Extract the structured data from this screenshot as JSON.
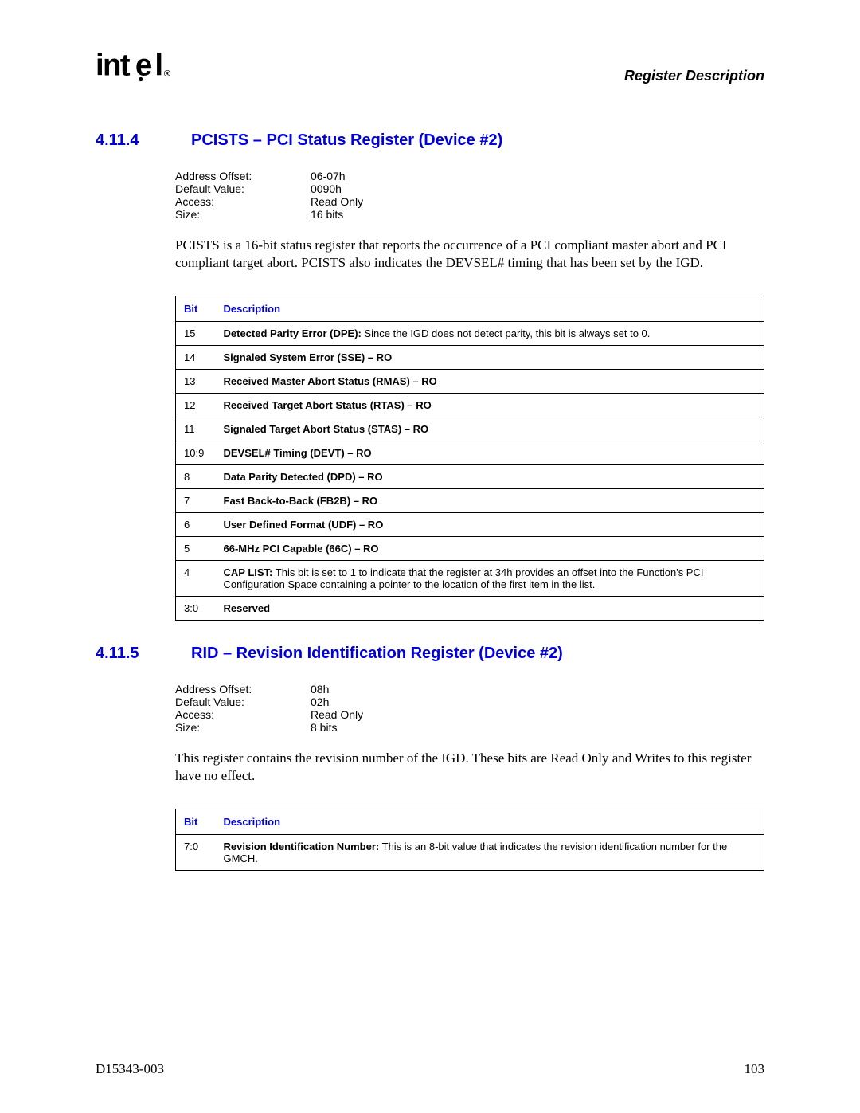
{
  "header": {
    "title": "Register Description",
    "logo_alt": "intel"
  },
  "footer": {
    "doc_number": "D15343-003",
    "page_number": "103"
  },
  "sections": [
    {
      "num": "4.11.4",
      "title": "PCISTS – PCI Status Register (Device #2)",
      "kv": [
        {
          "label": "Address Offset:",
          "value": "06-07h"
        },
        {
          "label": "Default Value:",
          "value": "0090h"
        },
        {
          "label": "Access:",
          "value": "Read Only"
        },
        {
          "label": "Size:",
          "value": "16 bits"
        }
      ],
      "body": "PCISTS is a 16-bit status register that reports the occurrence of a PCI compliant master abort and PCI compliant target abort. PCISTS also indicates the DEVSEL# timing that has been set by the IGD.",
      "table": {
        "headers": {
          "bit": "Bit",
          "desc": "Description"
        },
        "rows": [
          {
            "bit": "15",
            "bold": "Detected Parity Error (DPE):",
            "rest": "  Since the IGD does not detect parity, this bit is always set to 0."
          },
          {
            "bit": "14",
            "bold": "Signaled System Error (SSE) – RO",
            "rest": ""
          },
          {
            "bit": "13",
            "bold": "Received Master Abort Status (RMAS) – RO",
            "rest": ""
          },
          {
            "bit": "12",
            "bold": "Received Target Abort Status (RTAS) – RO",
            "rest": ""
          },
          {
            "bit": "11",
            "bold": "Signaled Target Abort Status (STAS) – RO",
            "rest": ""
          },
          {
            "bit": "10:9",
            "bold": "DEVSEL# Timing (DEVT) – RO",
            "rest": ""
          },
          {
            "bit": "8",
            "bold": "Data Parity Detected (DPD) – RO",
            "rest": ""
          },
          {
            "bit": "7",
            "bold": "Fast Back-to-Back (FB2B) – RO",
            "rest": ""
          },
          {
            "bit": "6",
            "bold": "User Defined Format (UDF) – RO",
            "rest": ""
          },
          {
            "bit": "5",
            "bold": "66-MHz PCI Capable (66C) – RO",
            "rest": ""
          },
          {
            "bit": "4",
            "bold": "CAP LIST:",
            "rest": "  This bit is set to 1 to indicate that the register at 34h provides an offset into the Function's PCI Configuration Space containing a pointer to the location of the first item in the list."
          },
          {
            "bit": "3:0",
            "bold": "Reserved",
            "rest": ""
          }
        ]
      }
    },
    {
      "num": "4.11.5",
      "title": "RID – Revision Identification Register (Device #2)",
      "kv": [
        {
          "label": "Address Offset:",
          "value": "08h"
        },
        {
          "label": "Default Value:",
          "value": "02h"
        },
        {
          "label": "Access:",
          "value": "Read Only"
        },
        {
          "label": "Size:",
          "value": "8 bits"
        }
      ],
      "body": "This register contains the revision number of the IGD. These bits are Read Only and Writes to this register have no effect.",
      "table": {
        "headers": {
          "bit": "Bit",
          "desc": "Description"
        },
        "rows": [
          {
            "bit": "7:0",
            "bold": "Revision Identification Number:",
            "rest": "  This is an 8-bit value that indicates the revision identification number for the GMCH."
          }
        ]
      }
    }
  ]
}
